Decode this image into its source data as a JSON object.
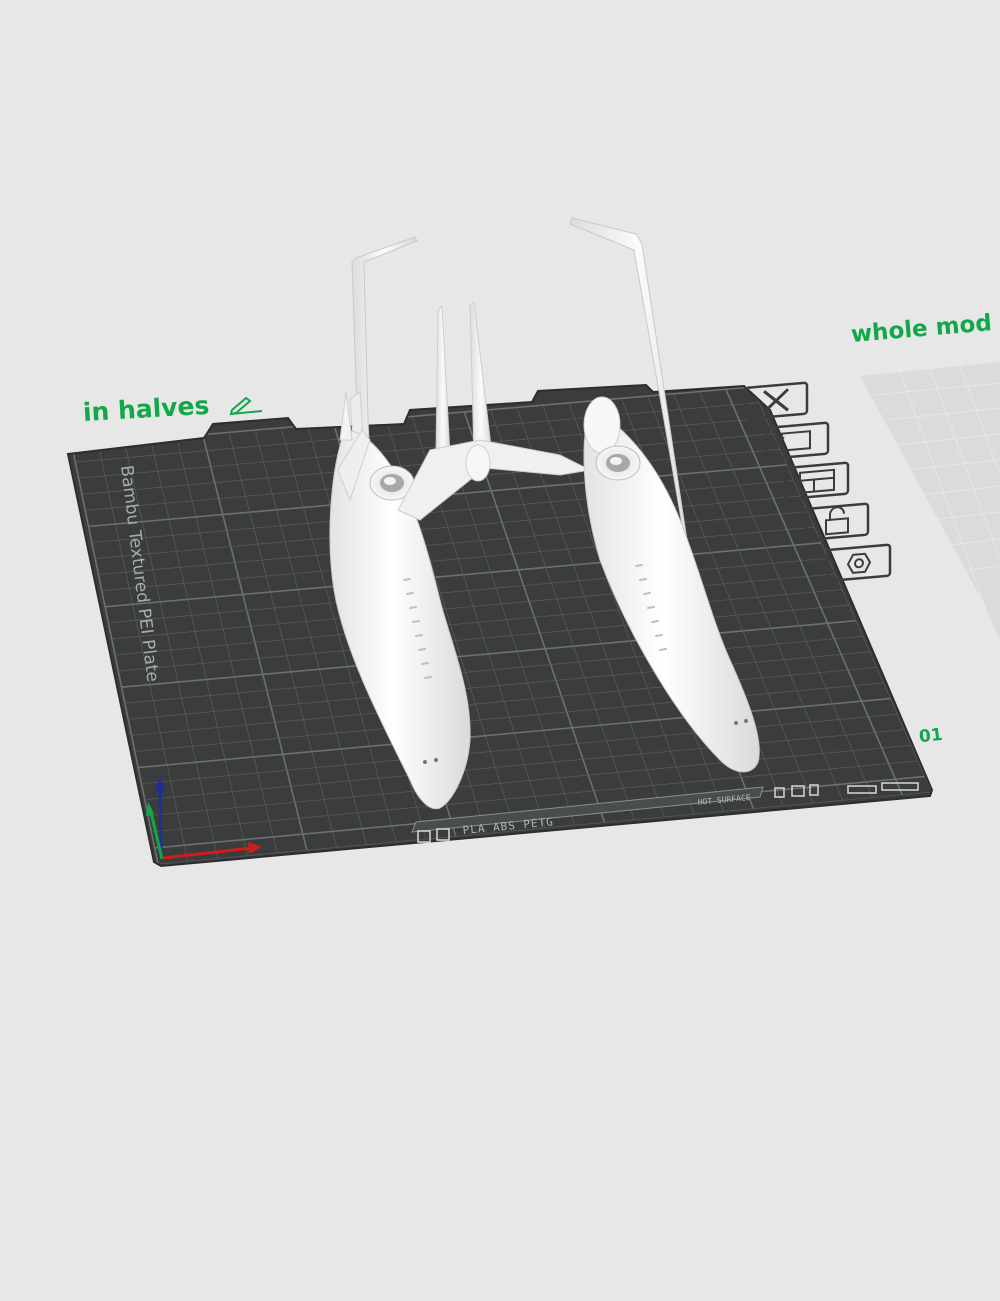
{
  "plates": [
    {
      "label": "in halves",
      "number": "01",
      "brand_text": "Bambu Textured PEI Plate",
      "filament_text": "PLA ABS PETG",
      "surface_text": "HOT SURFACE"
    },
    {
      "label": "whole mod"
    }
  ],
  "plate_toolbar_icons": [
    "close-icon",
    "auto-orient-icon",
    "arrange-icon",
    "lock-icon",
    "settings-icon"
  ],
  "colors": {
    "accent": "#12a84a",
    "plate": "#3b3d3d",
    "grid": "#5e6161",
    "model": "#f4f4f4",
    "background": "#e6e7e6"
  }
}
